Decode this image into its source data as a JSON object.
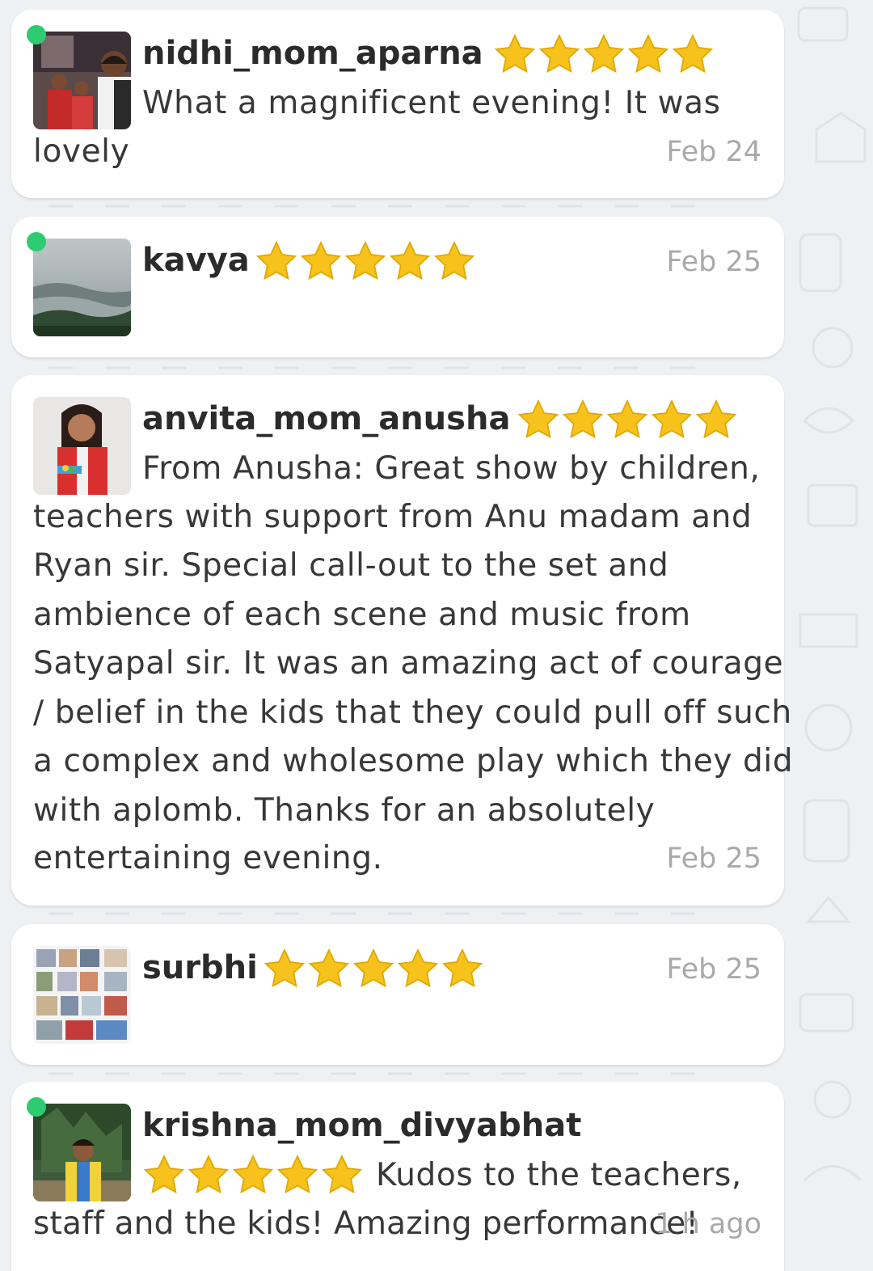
{
  "reviews": [
    {
      "username": "nidhi_mom_aparna",
      "rating": 5,
      "online": true,
      "avatar_icon": "family-photo-avatar",
      "message_lines": [
        "What a magnificent evening! It was",
        "lovely"
      ],
      "date": "Feb 24"
    },
    {
      "username": "kavya",
      "rating": 5,
      "online": true,
      "avatar_icon": "landscape-photo-avatar",
      "message_lines": [],
      "date": "Feb 25"
    },
    {
      "username": "anvita_mom_anusha",
      "rating": 5,
      "online": false,
      "avatar_icon": "girl-photo-avatar",
      "message_lines": [
        "From Anusha: Great show by children,",
        "teachers with support from Anu madam and",
        "Ryan sir. Special call-out to the set and",
        "ambience of each scene and music from",
        "Satyapal sir. It was an amazing act of courage",
        "/ belief in the kids that they could pull off such",
        "a complex and wholesome play which they did",
        "with aplomb. Thanks for an absolutely",
        "entertaining evening."
      ],
      "date": "Feb 25"
    },
    {
      "username": "surbhi",
      "rating": 5,
      "online": false,
      "avatar_icon": "photo-collage-avatar",
      "message_lines": [],
      "date": "Feb 25"
    },
    {
      "username": "krishna_mom_divyabhat",
      "rating": 5,
      "online": true,
      "avatar_icon": "boy-photo-avatar",
      "message_lines": [
        "Kudos to the teachers,",
        "staff and the kids! Amazing performance!"
      ],
      "date": "1 h ago"
    }
  ],
  "colors": {
    "star": "#f7c21b",
    "online": "#2ecc71",
    "card": "#ffffff",
    "background": "#eef1f4",
    "date": "#a9a9a9"
  }
}
